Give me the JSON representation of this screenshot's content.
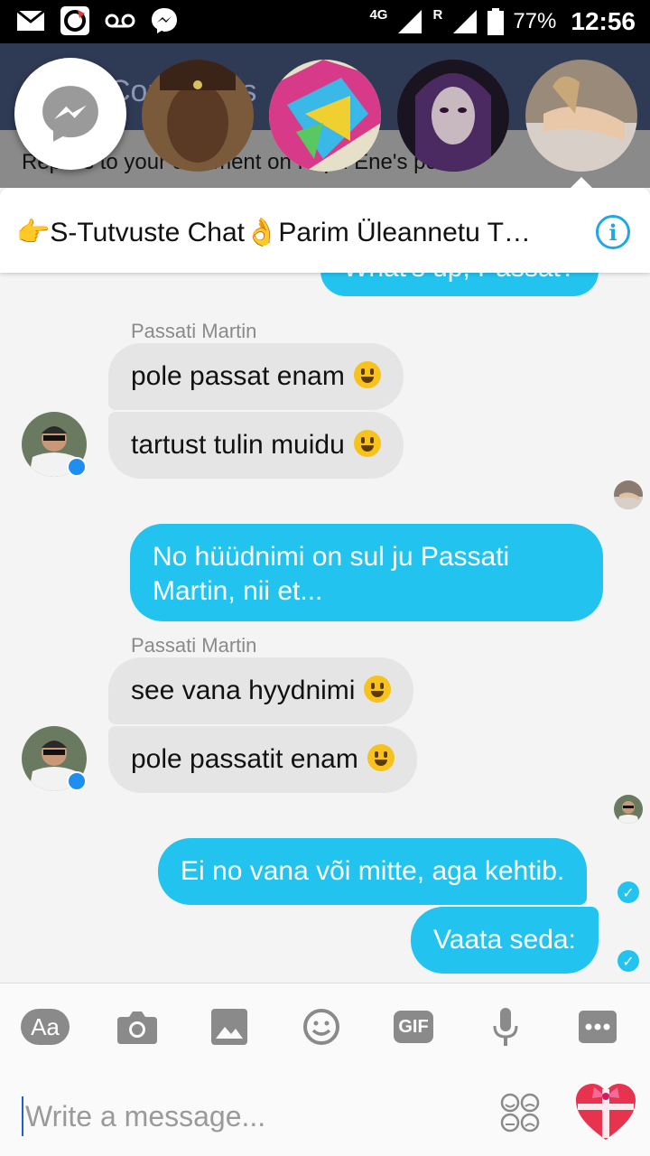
{
  "status_bar": {
    "network": "4G",
    "roaming": "R",
    "battery": "77%",
    "time": "12:56"
  },
  "background_app": {
    "title": "Comments",
    "notification": "Replies to your comment on Kirpu Ene's post."
  },
  "chat": {
    "title": "👉S-Tutvuste Chat👌Parim Üleannetu T…",
    "partial_top_message": "What's up, Passat?",
    "groups": [
      {
        "sender": "Passati Martin",
        "messages": [
          "pole passat enam",
          "tartust tulin muidu"
        ]
      },
      {
        "sender": "Passati Martin",
        "messages": [
          "see vana hyydnimi",
          "pole passatit enam"
        ]
      }
    ],
    "outgoing": [
      "No hüüdnimi on sul ju Passati",
      "Martin, nii et...",
      "Ei no vana või mitte, aga kehtib.",
      "Vaata seda:"
    ]
  },
  "toolbar": {
    "text_button": "Aa",
    "gif_button": "GIF",
    "icons": [
      "camera-icon",
      "gallery-icon",
      "emoji-icon",
      "microphone-icon",
      "more-icon"
    ]
  },
  "composer": {
    "placeholder": "Write a message..."
  },
  "colors": {
    "outgoing_bubble": "#22c4ef",
    "incoming_bubble": "#e5e5e5",
    "accent": "#1ea8e4"
  }
}
